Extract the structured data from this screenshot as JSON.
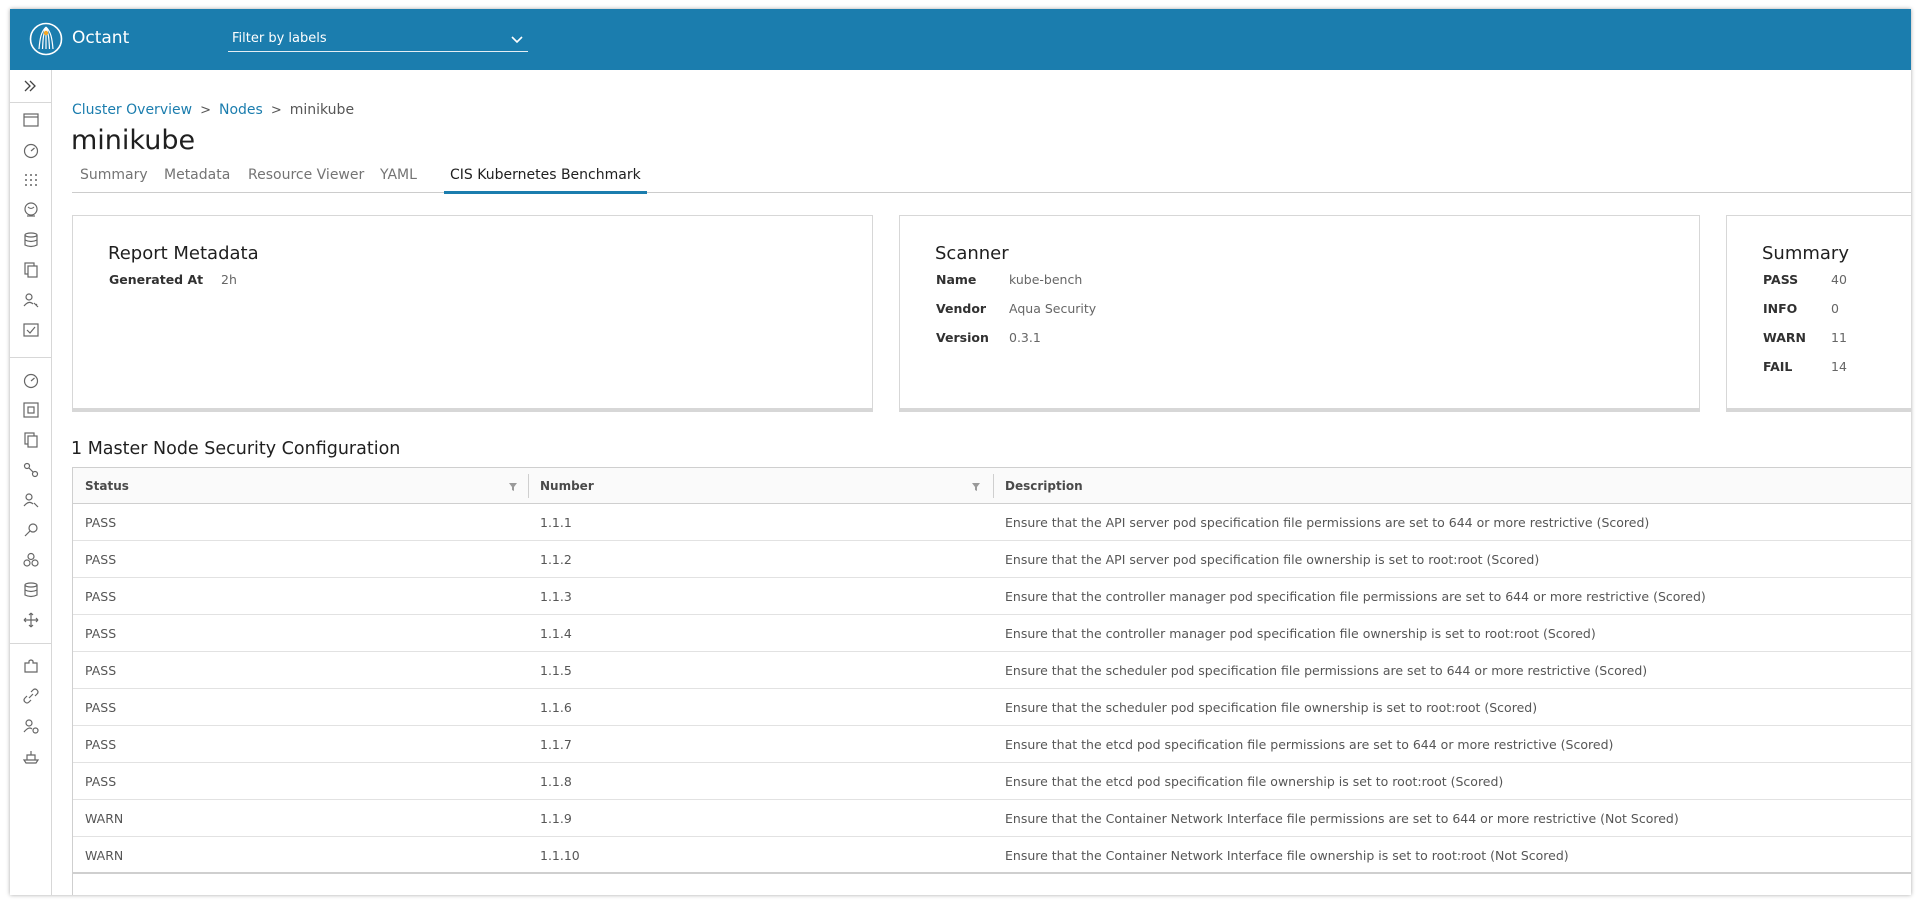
{
  "header": {
    "app_name": "Octant",
    "filter_placeholder": "Filter by labels"
  },
  "breadcrumb": {
    "items": [
      "Cluster Overview",
      "Nodes"
    ],
    "separator": ">",
    "current": "minikube"
  },
  "page_title": "minikube",
  "tabs": [
    {
      "label": "Summary"
    },
    {
      "label": "Metadata"
    },
    {
      "label": "Resource Viewer"
    },
    {
      "label": "YAML"
    },
    {
      "label": "CIS Kubernetes Benchmark",
      "active": true
    }
  ],
  "report_metadata": {
    "title": "Report Metadata",
    "generated_at_label": "Generated At",
    "generated_at_value": "2h"
  },
  "scanner": {
    "title": "Scanner",
    "rows": [
      {
        "label": "Name",
        "value": "kube-bench"
      },
      {
        "label": "Vendor",
        "value": "Aqua Security"
      },
      {
        "label": "Version",
        "value": "0.3.1"
      }
    ]
  },
  "summary": {
    "title": "Summary",
    "rows": [
      {
        "label": "PASS",
        "value": "40"
      },
      {
        "label": "INFO",
        "value": "0"
      },
      {
        "label": "WARN",
        "value": "11"
      },
      {
        "label": "FAIL",
        "value": "14"
      }
    ]
  },
  "section_title": "1 Master Node Security Configuration",
  "table": {
    "columns": [
      "Status",
      "Number",
      "Description"
    ],
    "rows": [
      {
        "status": "PASS",
        "number": "1.1.1",
        "description": "Ensure that the API server pod specification file permissions are set to 644 or more restrictive (Scored)"
      },
      {
        "status": "PASS",
        "number": "1.1.2",
        "description": "Ensure that the API server pod specification file ownership is set to root:root (Scored)"
      },
      {
        "status": "PASS",
        "number": "1.1.3",
        "description": "Ensure that the controller manager pod specification file permissions are set to 644 or more restrictive (Scored)"
      },
      {
        "status": "PASS",
        "number": "1.1.4",
        "description": "Ensure that the controller manager pod specification file ownership is set to root:root (Scored)"
      },
      {
        "status": "PASS",
        "number": "1.1.5",
        "description": "Ensure that the scheduler pod specification file permissions are set to 644 or more restrictive (Scored)"
      },
      {
        "status": "PASS",
        "number": "1.1.6",
        "description": "Ensure that the scheduler pod specification file ownership is set to root:root (Scored)"
      },
      {
        "status": "PASS",
        "number": "1.1.7",
        "description": "Ensure that the etcd pod specification file permissions are set to 644 or more restrictive (Scored)"
      },
      {
        "status": "PASS",
        "number": "1.1.8",
        "description": "Ensure that the etcd pod specification file ownership is set to root:root (Scored)"
      },
      {
        "status": "WARN",
        "number": "1.1.9",
        "description": "Ensure that the Container Network Interface file permissions are set to 644 or more restrictive (Not Scored)"
      },
      {
        "status": "WARN",
        "number": "1.1.10",
        "description": "Ensure that the Container Network Interface file ownership is set to root:root (Not Scored)"
      }
    ]
  },
  "sidebar": {
    "icons": [
      "browser-icon",
      "dashboard-icon",
      "grid-icon",
      "globe-icon",
      "storage-icon",
      "copy-icon",
      "user-key-icon",
      "checklist-icon",
      "dashboard-icon",
      "cluster-icon",
      "copy-icon",
      "network-icon",
      "user-key-icon",
      "key-icon",
      "circles-icon",
      "storage-icon",
      "move-icon",
      "plugin-icon",
      "link-icon",
      "user-settings-icon",
      "ship-icon"
    ]
  },
  "colors": {
    "header": "#1b7dae",
    "link": "#1b7dae",
    "active_tab": "#1b7dae"
  }
}
